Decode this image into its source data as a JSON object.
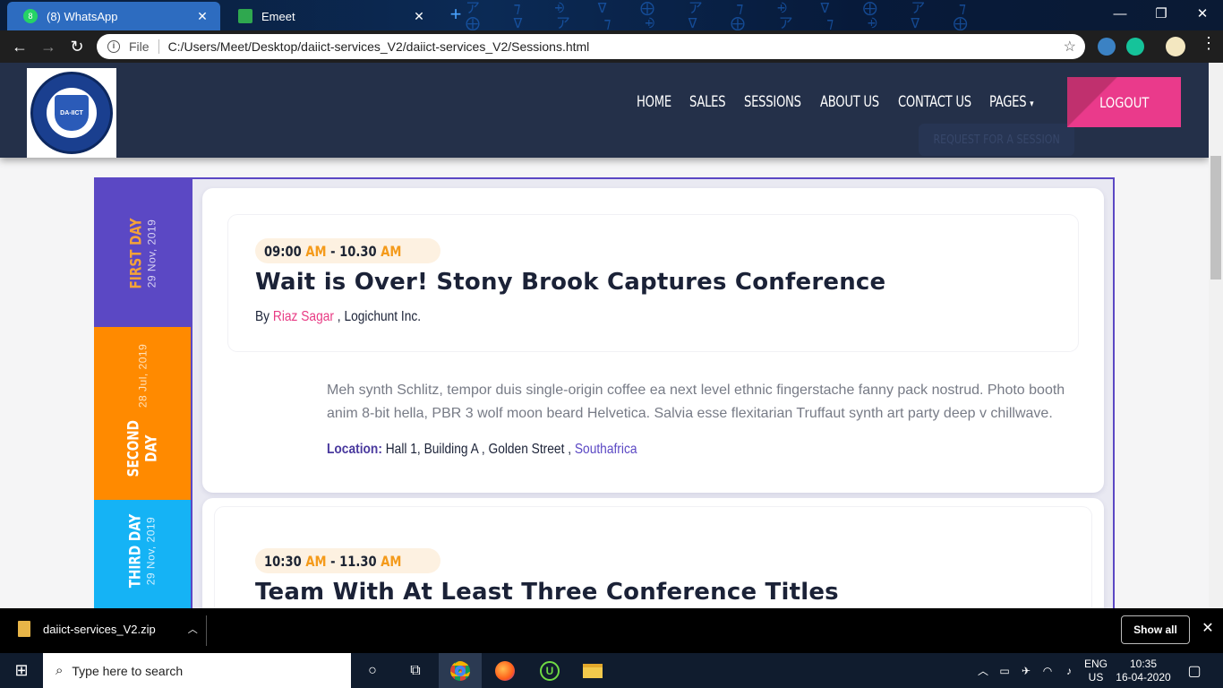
{
  "browser": {
    "tabs": [
      {
        "title": "(8) WhatsApp",
        "badge": "8",
        "active": true
      },
      {
        "title": "Emeet",
        "active": false
      }
    ],
    "address": {
      "scheme_label": "File",
      "url": "C:/Users/Meet/Desktop/daiict-services_V2/daiict-services_V2/Sessions.html"
    }
  },
  "site": {
    "logo_text": "DA-IICT",
    "nav": [
      "HOME",
      "SALES",
      "SESSIONS",
      "ABOUT US",
      "CONTACT US",
      "PAGES"
    ],
    "logout_label": "LOGOUT",
    "ghost_button_label": "REQUEST FOR A SESSION"
  },
  "days": [
    {
      "name": "FIRST DAY",
      "date": "29 Nov, 2019",
      "color": "#5b48c4",
      "name_color": "#f4a238"
    },
    {
      "name": "SECOND DAY",
      "name_line1": "SECOND",
      "name_line2": "DAY",
      "date": "28 Jul, 2019",
      "color": "#ff8a00",
      "name_color": "#ffffff"
    },
    {
      "name": "THIRD DAY",
      "date": "29 Nov, 2019",
      "color": "#15b3f5",
      "name_color": "#ffffff"
    }
  ],
  "sessions": [
    {
      "start": "09:00",
      "start_ampm": "AM",
      "dash": "-",
      "end": "10.30",
      "end_ampm": "AM",
      "title": "Wait is Over! Stony Brook Captures Conference",
      "by_prefix": "By",
      "speaker": "Riaz Sagar",
      "company": ", Logichunt Inc.",
      "description": "Meh synth Schlitz, tempor duis single-origin coffee ea next level ethnic fingerstache fanny pack nostrud. Photo booth anim 8-bit hella, PBR 3 wolf moon beard Helvetica. Salvia esse flexitarian Truffaut synth art party deep v chillwave.",
      "location_label": "Location:",
      "location": "Hall 1, Building A , Golden Street ,",
      "country": "Southafrica"
    },
    {
      "start": "10:30",
      "start_ampm": "AM",
      "dash": "-",
      "end": "11.30",
      "end_ampm": "AM",
      "title": "Team With At Least Three Conference Titles"
    }
  ],
  "downloads": {
    "file": "daiict-services_V2.zip",
    "show_all": "Show all"
  },
  "taskbar": {
    "search_placeholder": "Type here to search",
    "lang_top": "ENG",
    "lang_bottom": "US",
    "time": "10:35",
    "date": "16-04-2020"
  }
}
